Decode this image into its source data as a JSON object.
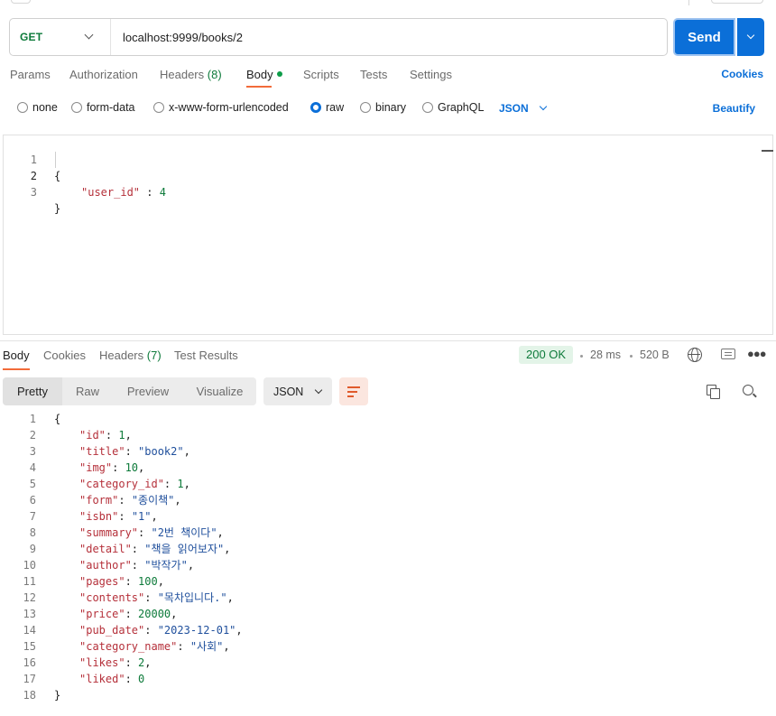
{
  "request": {
    "method": "GET",
    "url": "localhost:9999/books/2",
    "send_label": "Send"
  },
  "request_tabs": [
    {
      "label": "Params"
    },
    {
      "label": "Authorization"
    },
    {
      "label": "Headers",
      "count": "(8)"
    },
    {
      "label": "Body",
      "active": true
    },
    {
      "label": "Scripts"
    },
    {
      "label": "Tests"
    },
    {
      "label": "Settings"
    }
  ],
  "cookies_label": "Cookies",
  "body_types": [
    {
      "label": "none",
      "checked": false
    },
    {
      "label": "form-data",
      "checked": false
    },
    {
      "label": "x-www-form-urlencoded",
      "checked": false
    },
    {
      "label": "raw",
      "checked": true
    },
    {
      "label": "binary",
      "checked": false
    },
    {
      "label": "GraphQL",
      "checked": false
    }
  ],
  "raw_format": "JSON",
  "beautify_label": "Beautify",
  "request_body": {
    "lines": [
      {
        "n": "1",
        "text": "{"
      },
      {
        "n": "2",
        "key": "\"user_id\"",
        "sep": " : ",
        "value": "4",
        "vtype": "num"
      },
      {
        "n": "3",
        "text": "}"
      }
    ]
  },
  "response_tabs": [
    {
      "label": "Body",
      "active": true
    },
    {
      "label": "Cookies"
    },
    {
      "label": "Headers",
      "count": "(7)"
    },
    {
      "label": "Test Results"
    }
  ],
  "response_meta": {
    "status": "200 OK",
    "time": "28 ms",
    "size": "520 B"
  },
  "view_modes": [
    "Pretty",
    "Raw",
    "Preview",
    "Visualize"
  ],
  "response_format": "JSON",
  "response_body": {
    "lines": [
      {
        "n": "1",
        "text": "{"
      },
      {
        "n": "2",
        "key": "\"id\"",
        "value": "1",
        "vtype": "num",
        "comma": true
      },
      {
        "n": "3",
        "key": "\"title\"",
        "value": "\"book2\"",
        "vtype": "str",
        "comma": true
      },
      {
        "n": "4",
        "key": "\"img\"",
        "value": "10",
        "vtype": "num",
        "comma": true
      },
      {
        "n": "5",
        "key": "\"category_id\"",
        "value": "1",
        "vtype": "num",
        "comma": true
      },
      {
        "n": "6",
        "key": "\"form\"",
        "value": "\"종이책\"",
        "vtype": "str",
        "comma": true
      },
      {
        "n": "7",
        "key": "\"isbn\"",
        "value": "\"1\"",
        "vtype": "str",
        "comma": true
      },
      {
        "n": "8",
        "key": "\"summary\"",
        "value": "\"2번 책이다\"",
        "vtype": "str",
        "comma": true
      },
      {
        "n": "9",
        "key": "\"detail\"",
        "value": "\"책을 읽어보자\"",
        "vtype": "str",
        "comma": true
      },
      {
        "n": "10",
        "key": "\"author\"",
        "value": "\"박작가\"",
        "vtype": "str",
        "comma": true
      },
      {
        "n": "11",
        "key": "\"pages\"",
        "value": "100",
        "vtype": "num",
        "comma": true
      },
      {
        "n": "12",
        "key": "\"contents\"",
        "value": "\"목차입니다.\"",
        "vtype": "str",
        "comma": true
      },
      {
        "n": "13",
        "key": "\"price\"",
        "value": "20000",
        "vtype": "num",
        "comma": true
      },
      {
        "n": "14",
        "key": "\"pub_date\"",
        "value": "\"2023-12-01\"",
        "vtype": "str",
        "comma": true
      },
      {
        "n": "15",
        "key": "\"category_name\"",
        "value": "\"사회\"",
        "vtype": "str",
        "comma": true
      },
      {
        "n": "16",
        "key": "\"likes\"",
        "value": "2",
        "vtype": "num",
        "comma": true
      },
      {
        "n": "17",
        "key": "\"liked\"",
        "value": "0",
        "vtype": "num",
        "comma": false
      },
      {
        "n": "18",
        "text": "}"
      }
    ]
  },
  "colors": {
    "accent": "#0b6fd8",
    "method_get": "#0d7a3a",
    "tab_underline": "#f26b3a",
    "json_key": "#b5303a",
    "json_string": "#1f4f9c",
    "json_number": "#0d7a3a"
  }
}
